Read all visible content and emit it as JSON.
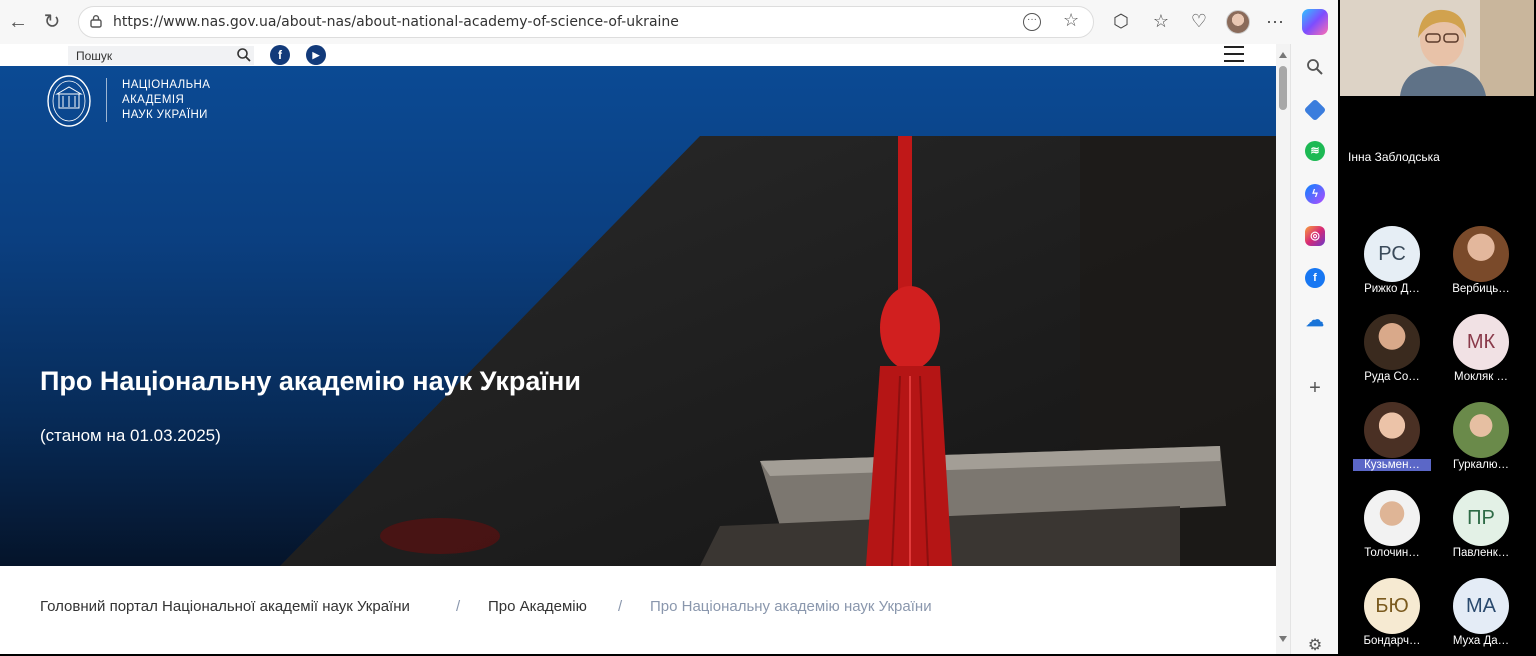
{
  "browser": {
    "url": "https://www.nas.gov.ua/about-nas/about-national-academy-of-science-of-ukraine"
  },
  "page": {
    "search_placeholder": "Пошук",
    "social": [
      "f",
      "▶"
    ],
    "logo_lines": [
      "НАЦІОНАЛЬНА",
      "АКАДЕМІЯ",
      "НАУК УКРАЇНИ"
    ],
    "hero_title": "Про Національну академію наук України",
    "hero_subtitle": "(станом на 01.03.2025)",
    "breadcrumb": {
      "items": [
        "Головний портал Національної академії наук України",
        "Про Академію",
        "Про Національну академію наук України"
      ],
      "separator": "/"
    }
  },
  "call": {
    "speaker_name": "Інна Заблодська",
    "participants": [
      {
        "initials": "РС",
        "name": "Рижко Д…"
      },
      {
        "initials": "",
        "name": "Вербиць…"
      },
      {
        "initials": "",
        "name": "Руда Со…"
      },
      {
        "initials": "МК",
        "name": "Мокляк …"
      },
      {
        "initials": "",
        "name": "Кузьмен…"
      },
      {
        "initials": "",
        "name": "Гуркалю…"
      },
      {
        "initials": "",
        "name": "Толочин…"
      },
      {
        "initials": "ПР",
        "name": "Павленк…"
      },
      {
        "initials": "БЮ",
        "name": "Бондарч…"
      },
      {
        "initials": "МА",
        "name": "Муха Да…"
      }
    ]
  },
  "colors": {
    "hero_blue": "#0b4a94",
    "tassel_red": "#d11f1f",
    "highlight": "#5b67c7"
  }
}
